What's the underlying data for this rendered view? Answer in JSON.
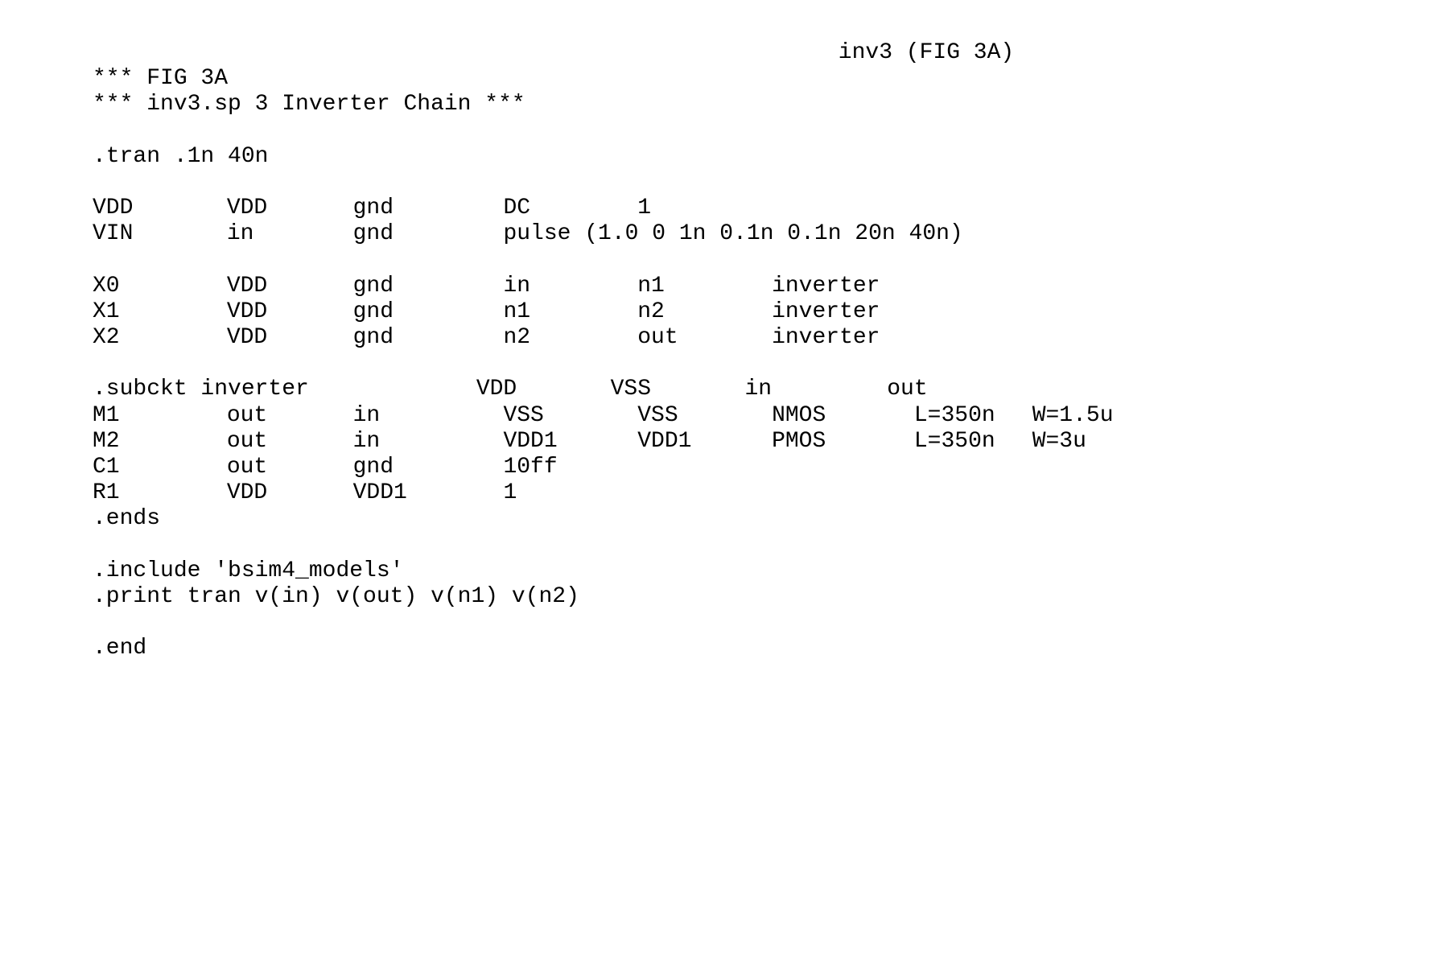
{
  "header": {
    "title": "inv3 (FIG 3A)"
  },
  "lines": {
    "comment1": "*** FIG 3A",
    "comment2": "*** inv3.sp 3 Inverter Chain ***",
    "tran": ".tran .1n 40n",
    "vdd": {
      "c1": "VDD",
      "c2": "VDD",
      "c3": "gnd",
      "c4": "DC",
      "c5": "1"
    },
    "vin": {
      "c1": "VIN",
      "c2": "in",
      "c3": "gnd",
      "c4": "pulse (1.0 0 1n 0.1n 0.1n 20n 40n)"
    },
    "x0": {
      "c1": "X0",
      "c2": "VDD",
      "c3": "gnd",
      "c4": "in",
      "c5": "n1",
      "c6": "inverter"
    },
    "x1": {
      "c1": "X1",
      "c2": "VDD",
      "c3": "gnd",
      "c4": "n1",
      "c5": "n2",
      "c6": "inverter"
    },
    "x2": {
      "c1": "X2",
      "c2": "VDD",
      "c3": "gnd",
      "c4": "n2",
      "c5": "out",
      "c6": "inverter"
    },
    "subckt": {
      "c1": ".subckt inverter",
      "c4": "VDD",
      "c5": "VSS",
      "c6": "in",
      "c7": "out"
    },
    "m1": {
      "c1": "M1",
      "c2": "out",
      "c3": "in",
      "c4": "VSS",
      "c5": "VSS",
      "c6": "NMOS",
      "c7": "L=350n",
      "c8": "W=1.5u"
    },
    "m2": {
      "c1": "M2",
      "c2": "out",
      "c3": "in",
      "c4": "VDD1",
      "c5": "VDD1",
      "c6": "PMOS",
      "c7": "L=350n",
      "c8": "W=3u"
    },
    "c1line": {
      "c1": "C1",
      "c2": "out",
      "c3": "gnd",
      "c4": "10ff"
    },
    "r1": {
      "c1": "R1",
      "c2": "VDD",
      "c3": "VDD1",
      "c4": "1"
    },
    "ends": ".ends",
    "include": ".include 'bsim4_models'",
    "print": ".print tran v(in) v(out) v(n1) v(n2)",
    "end": ".end"
  }
}
